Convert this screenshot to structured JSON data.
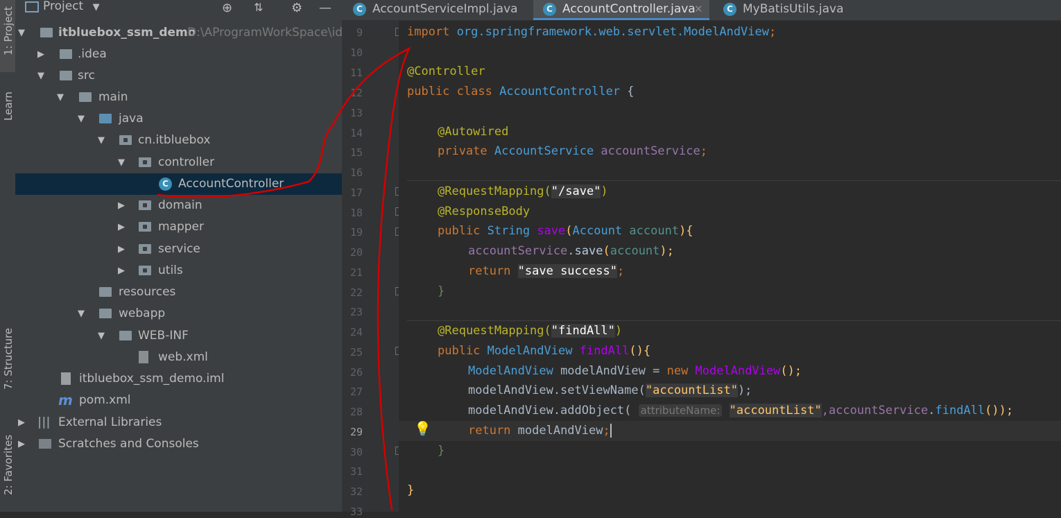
{
  "tool_strip": {
    "tab_project": "1: Project",
    "tab_learn": "Learn",
    "tab_structure": "7: Structure",
    "tab_favorites": "2: Favorites"
  },
  "project_panel": {
    "title": "Project",
    "tree": [
      {
        "label": "itbluebox_ssm_demo",
        "extra": "D:\\AProgramWorkSpace\\ide"
      },
      {
        "label": ".idea"
      },
      {
        "label": "src"
      },
      {
        "label": "main"
      },
      {
        "label": "java"
      },
      {
        "label": "cn.itbluebox"
      },
      {
        "label": "controller"
      },
      {
        "label": "AccountController"
      },
      {
        "label": "domain"
      },
      {
        "label": "mapper"
      },
      {
        "label": "service"
      },
      {
        "label": "utils"
      },
      {
        "label": "resources"
      },
      {
        "label": "webapp"
      },
      {
        "label": "WEB-INF"
      },
      {
        "label": "web.xml"
      },
      {
        "label": "itbluebox_ssm_demo.iml"
      },
      {
        "label": "pom.xml"
      },
      {
        "label": "External Libraries"
      },
      {
        "label": "Scratches and Consoles"
      }
    ]
  },
  "tabs": [
    {
      "label": "AccountServiceImpl.java"
    },
    {
      "label": "AccountController.java",
      "close": "✕"
    },
    {
      "label": "MyBatisUtils.java"
    }
  ],
  "editor": {
    "line_numbers": [
      "9",
      "10",
      "11",
      "12",
      "13",
      "14",
      "15",
      "16",
      "17",
      "18",
      "19",
      "20",
      "21",
      "22",
      "23",
      "24",
      "25",
      "26",
      "27",
      "28",
      "29",
      "30",
      "31",
      "32",
      "33"
    ],
    "current_line": "29",
    "code": {
      "l9_kw": "import ",
      "l9_pkg": "org.springframework.web.servlet.ModelAndView",
      "l9_semi": ";",
      "l11": "@Controller",
      "l12_kw": "public class ",
      "l12_name": "AccountController ",
      "l12_brace": "{",
      "l14": "@Autowired",
      "l15_kw": "private ",
      "l15_type": "AccountService ",
      "l15_field": "accountService",
      "l15_semi": ";",
      "l17_ann": "@RequestMapping(",
      "l17_str": "\"/save\"",
      "l17_close": ")",
      "l18": "@ResponseBody",
      "l19_kw": "public ",
      "l19_type": "String ",
      "l19_method": "save",
      "l19_open": "(",
      "l19_ptype": "Account ",
      "l19_param": "account",
      "l19_close": "){",
      "l20_field": "accountService",
      "l20_dot": ".",
      "l20_method": "save",
      "l20_open": "(",
      "l20_arg": "account",
      "l20_close": ");",
      "l21_kw": "return ",
      "l21_str": "\"save success\"",
      "l21_semi": ";",
      "l22": "}",
      "l24_ann": "@RequestMapping(",
      "l24_str": "\"findAll\"",
      "l24_close": ")",
      "l25_kw": "public ",
      "l25_type": "ModelAndView ",
      "l25_method": "findAll",
      "l25_close": "(){",
      "l26_type": "ModelAndView ",
      "l26_var": "modelAndView = ",
      "l26_new": "new ",
      "l26_ctor": "ModelAndView",
      "l26_close": "();",
      "l27_call": "modelAndView.setViewName(",
      "l27_str": "\"accountList\"",
      "l27_close": ");",
      "l28_call": "modelAndView.addObject( ",
      "l28_hint": "attributeName:",
      "l28_str": "\"accountList\"",
      "l28_comma": ",",
      "l28_field": "accountService",
      "l28_dot": ".",
      "l28_method": "findAll",
      "l28_close": "());",
      "l29_kw": "return ",
      "l29_var": "modelAndView",
      "l29_semi": ";",
      "l30": "}",
      "l32": "}"
    }
  },
  "colors": {
    "keyword": "#cc7832",
    "annotation": "#bbb529",
    "string": "#6a8759",
    "field": "#9876aa",
    "method": "#ffc66d",
    "annotation_red_ink": "#d40000"
  }
}
